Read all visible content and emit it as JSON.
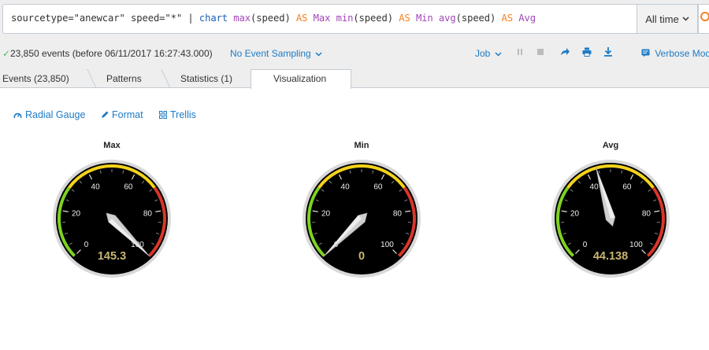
{
  "search": {
    "tokens": [
      {
        "text": "sourcetype=\"anewcar\" speed=\"*\" ",
        "cls": "t-str"
      },
      {
        "text": "| ",
        "cls": "t-pipe"
      },
      {
        "text": "chart ",
        "cls": "t-cmd"
      },
      {
        "text": "max",
        "cls": "t-fn"
      },
      {
        "text": "(speed) ",
        "cls": "t-str"
      },
      {
        "text": "AS ",
        "cls": "t-kw"
      },
      {
        "text": "Max ",
        "cls": "t-fn"
      },
      {
        "text": "min",
        "cls": "t-fn"
      },
      {
        "text": "(speed) ",
        "cls": "t-str"
      },
      {
        "text": "AS ",
        "cls": "t-kw"
      },
      {
        "text": "Min ",
        "cls": "t-fn"
      },
      {
        "text": "avg",
        "cls": "t-fn"
      },
      {
        "text": "(speed) ",
        "cls": "t-str"
      },
      {
        "text": "AS ",
        "cls": "t-kw"
      },
      {
        "text": "Avg",
        "cls": "t-fn"
      }
    ],
    "time_range": "All time"
  },
  "status": {
    "events_text": "23,850 events (before 06/11/2017 16:27:43.000)",
    "sampling": "No Event Sampling",
    "job": "Job",
    "mode": "Verbose Mod"
  },
  "tabs": [
    {
      "label": "Events (23,850)",
      "active": false
    },
    {
      "label": "Patterns",
      "active": false
    },
    {
      "label": "Statistics (1)",
      "active": false
    },
    {
      "label": "Visualization",
      "active": true
    }
  ],
  "viz_options": {
    "type": "Radial Gauge",
    "format": "Format",
    "trellis": "Trellis"
  },
  "colors": {
    "green": "#7ed321",
    "yellow": "#f4d31b",
    "red": "#d9362a",
    "value_text": "#c8b670",
    "link": "#1e7bc4"
  },
  "chart_data": [
    {
      "type": "radial_gauge",
      "title": "Max",
      "value": 145.3,
      "display": "145.3",
      "range": [
        0,
        100
      ],
      "ticks": [
        "0",
        "20",
        "40",
        "60",
        "80",
        "100"
      ],
      "bands": [
        {
          "from": 0,
          "to": 30,
          "color": "green"
        },
        {
          "from": 30,
          "to": 70,
          "color": "yellow"
        },
        {
          "from": 70,
          "to": 100,
          "color": "red"
        }
      ]
    },
    {
      "type": "radial_gauge",
      "title": "Min",
      "value": 0,
      "display": "0",
      "range": [
        0,
        100
      ],
      "ticks": [
        "0",
        "20",
        "40",
        "60",
        "80",
        "100"
      ],
      "bands": [
        {
          "from": 0,
          "to": 30,
          "color": "green"
        },
        {
          "from": 30,
          "to": 70,
          "color": "yellow"
        },
        {
          "from": 70,
          "to": 100,
          "color": "red"
        }
      ]
    },
    {
      "type": "radial_gauge",
      "title": "Avg",
      "value": 44.138,
      "display": "44.138",
      "range": [
        0,
        100
      ],
      "ticks": [
        "0",
        "20",
        "40",
        "60",
        "80",
        "100"
      ],
      "bands": [
        {
          "from": 0,
          "to": 30,
          "color": "green"
        },
        {
          "from": 30,
          "to": 70,
          "color": "yellow"
        },
        {
          "from": 70,
          "to": 100,
          "color": "red"
        }
      ]
    }
  ]
}
